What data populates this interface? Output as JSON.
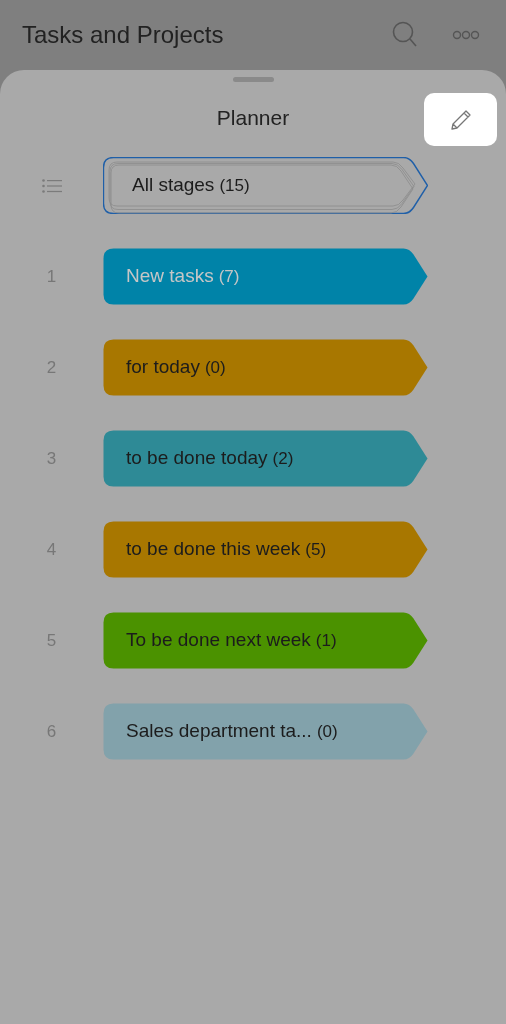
{
  "header": {
    "title": "Tasks and Projects"
  },
  "sheet": {
    "title": "Planner"
  },
  "stages": [
    {
      "kind": "all",
      "label": "All stages",
      "count": "(15)",
      "color": "#a9a9a9",
      "light_text": false,
      "selected": true
    },
    {
      "kind": "stage",
      "marker": "1",
      "label": "New tasks",
      "count": "(7)",
      "color": "#0083a8",
      "light_text": true,
      "selected": false
    },
    {
      "kind": "stage",
      "marker": "2",
      "label": "for today",
      "count": "(0)",
      "color": "#a87700",
      "light_text": false,
      "selected": false
    },
    {
      "kind": "stage",
      "marker": "3",
      "label": "to be done today",
      "count": "(2)",
      "color": "#2e8a96",
      "light_text": false,
      "selected": false
    },
    {
      "kind": "stage",
      "marker": "4",
      "label": "to be done this week",
      "count": "(5)",
      "color": "#a87700",
      "light_text": false,
      "selected": false
    },
    {
      "kind": "stage",
      "marker": "5",
      "label": "To be done next week",
      "count": "(1)",
      "color": "#4b9200",
      "light_text": false,
      "selected": false
    },
    {
      "kind": "stage",
      "marker": "6",
      "label": "Sales department ta...",
      "count": "(0)",
      "color": "#82a2ab",
      "light_text": false,
      "selected": false
    }
  ]
}
